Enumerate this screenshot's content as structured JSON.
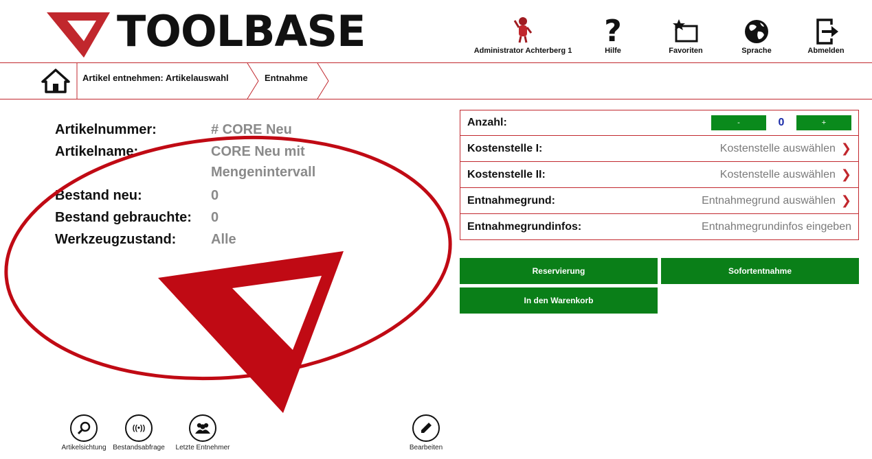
{
  "header": {
    "logo_text": "TOOLBASE",
    "user_label": "Administrator Achterberg 1",
    "help_label": "Hilfe",
    "favorites_label": "Favoriten",
    "language_label": "Sprache",
    "logout_label": "Abmelden"
  },
  "breadcrumb": {
    "items": [
      "Artikel entnehmen: Artikelauswahl",
      "Entnahme"
    ]
  },
  "article": {
    "number_label": "Artikelnummer:",
    "number_value": "# CORE Neu",
    "name_label": "Artikelname:",
    "name_value_line1": "CORE Neu mit",
    "name_value_line2": "Mengenintervall",
    "stock_new_label": "Bestand neu:",
    "stock_new_value": "0",
    "stock_used_label": "Bestand gebrauchte:",
    "stock_used_value": "0",
    "condition_label": "Werkzeugzustand:",
    "condition_value": "Alle"
  },
  "form": {
    "quantity_label": "Anzahl:",
    "quantity_minus": "-",
    "quantity_value": "0",
    "quantity_plus": "+",
    "cost_center_1_label": "Kostenstelle I:",
    "cost_center_1_value": "Kostenstelle auswählen",
    "cost_center_2_label": "Kostenstelle II:",
    "cost_center_2_value": "Kostenstelle auswählen",
    "reason_label": "Entnahmegrund:",
    "reason_value": "Entnahmegrund auswählen",
    "reason_info_label": "Entnahmegrundinfos:",
    "reason_info_placeholder": "Entnahmegrundinfos eingeben"
  },
  "actions": {
    "reserve": "Reservierung",
    "immediate": "Sofortentnahme",
    "cart": "In den Warenkorb"
  },
  "toolbar": {
    "article_view": "Artikelsichtung",
    "stock_query": "Bestandsabfrage",
    "last_takers": "Letzte Entnehmer",
    "edit": "Bearbeiten"
  },
  "colors": {
    "accent_red": "#c1272d",
    "button_green": "#0a7f18",
    "value_blue": "#1a2ba8"
  }
}
